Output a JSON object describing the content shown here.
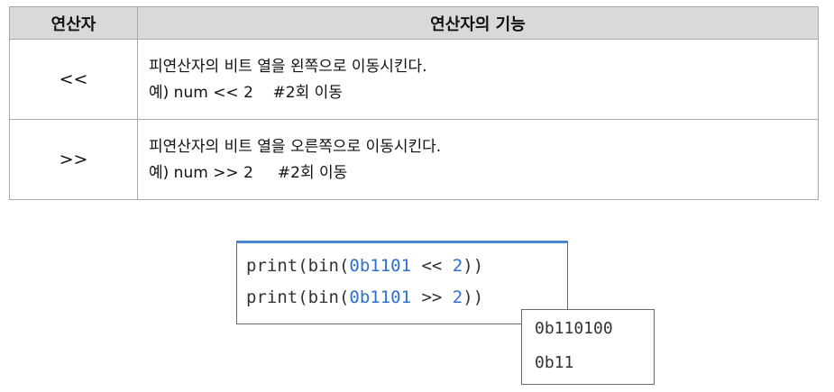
{
  "table": {
    "headers": [
      "연산자",
      "연산자의 기능"
    ],
    "rows": [
      {
        "operator": "<<",
        "description": "피연산자의 비트 열을 왼쪽으로 이동시킨다.",
        "example": "예) num << 2    #2회 이동"
      },
      {
        "operator": ">>",
        "description": "피연산자의 비트 열을 오른쪽으로 이동시킨다.",
        "example": "예) num >> 2     #2회 이동"
      }
    ]
  },
  "code": {
    "lines": [
      {
        "prefix": "print(bin(",
        "literal": "0b1101",
        "op": " << ",
        "arg": "2",
        "suffix": "))"
      },
      {
        "prefix": "print(bin(",
        "literal": "0b1101",
        "op": " >> ",
        "arg": "2",
        "suffix": "))"
      }
    ],
    "number_color": "#2e6fd0",
    "accent_color": "#4a86d8"
  },
  "output": {
    "lines": [
      "0b110100",
      "0b11"
    ]
  }
}
